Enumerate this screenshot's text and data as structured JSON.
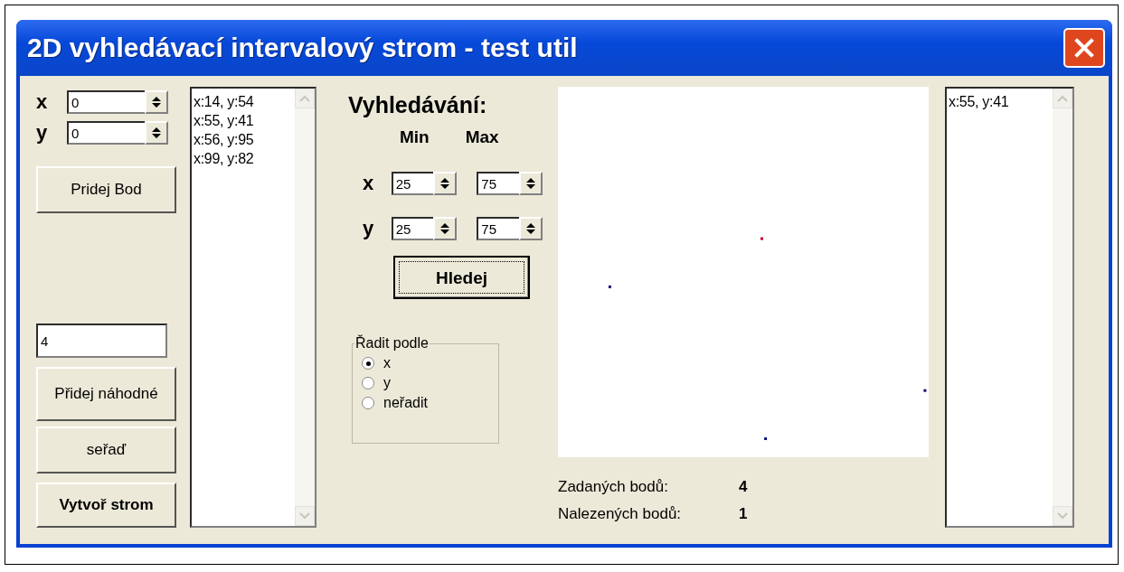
{
  "window": {
    "title": "2D vyhledávací intervalový strom - test util"
  },
  "point_input": [
    {
      "label": "x",
      "value": "0"
    },
    {
      "label": "y",
      "value": "0"
    }
  ],
  "add_point_button": "Pridej Bod",
  "points_list": [
    "x:14, y:54",
    "x:55, y:41",
    "x:56, y:95",
    "x:99, y:82"
  ],
  "random_count": {
    "value": "4"
  },
  "add_random_button": "Přidej náhodné",
  "sort_button": "seřaď",
  "build_tree_button": "Vytvoř strom",
  "search": {
    "heading": "Vyhledávání:",
    "min_label": "Min",
    "max_label": "Max",
    "rows": [
      {
        "label": "x",
        "min": "25",
        "max": "75"
      },
      {
        "label": "y",
        "min": "25",
        "max": "75"
      }
    ],
    "button": "Hledej"
  },
  "sort_group": {
    "title": "Řadit podle",
    "options": [
      {
        "label": "x",
        "selected": true
      },
      {
        "label": "y",
        "selected": false
      },
      {
        "label": "neřadit",
        "selected": false
      }
    ]
  },
  "stats": [
    {
      "label": "Zadaných bodů:",
      "value": "4"
    },
    {
      "label": "Nalezených bodů:",
      "value": "1"
    }
  ],
  "results_list": [
    "x:55, y:41"
  ]
}
